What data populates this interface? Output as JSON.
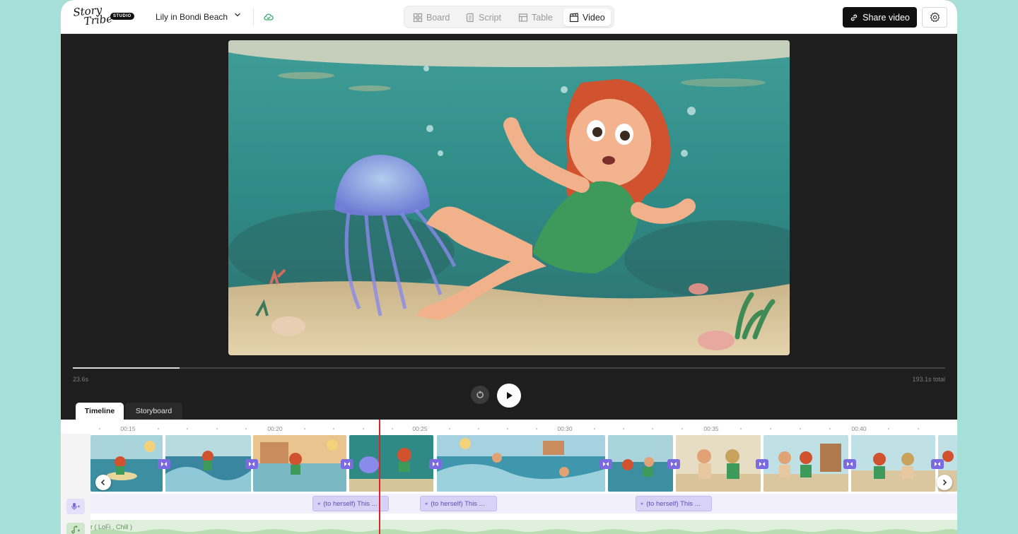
{
  "header": {
    "logo_line1": "Story",
    "logo_line2": "Tribe",
    "logo_badge": "STUDIO",
    "project_name": "Lily in Bondi Beach",
    "project_dropdown_icon": "chevron-down-icon",
    "sync_icon": "cloud-sync-icon",
    "tabs": [
      {
        "label": "Board",
        "icon": "grid-icon",
        "active": false
      },
      {
        "label": "Script",
        "icon": "script-icon",
        "active": false
      },
      {
        "label": "Table",
        "icon": "table-icon",
        "active": false
      },
      {
        "label": "Video",
        "icon": "clapperboard-icon",
        "active": true
      }
    ],
    "share_label": "Share video",
    "share_icon": "link-icon",
    "settings_icon": "gear-icon"
  },
  "player": {
    "current_time": "23.6s",
    "total_time": "193.1s total",
    "progress": 0.122,
    "replay_icon": "replay-icon",
    "play_icon": "play-icon"
  },
  "panel_tabs": [
    {
      "label": "Timeline",
      "active": true
    },
    {
      "label": "Storyboard",
      "active": false
    }
  ],
  "timeline": {
    "ruler_labels": [
      "00:15",
      "00:20",
      "00:25",
      "00:30",
      "00:35",
      "00:40"
    ],
    "speech_clips": [
      "(to herself) This ...",
      "(to herself) This ...",
      "(to herself) This ..."
    ],
    "music_label": "r ( LoFi , Chill )",
    "prev_icon": "chevron-left-icon",
    "next_icon": "chevron-right-icon",
    "mic_icon": "mic-icon",
    "music_icon": "music-note-icon"
  },
  "colors": {
    "accent": "#7b6ae0",
    "playhead": "#e0242b",
    "background": "#a7e0d8",
    "player_bg": "#1e1e1e"
  }
}
